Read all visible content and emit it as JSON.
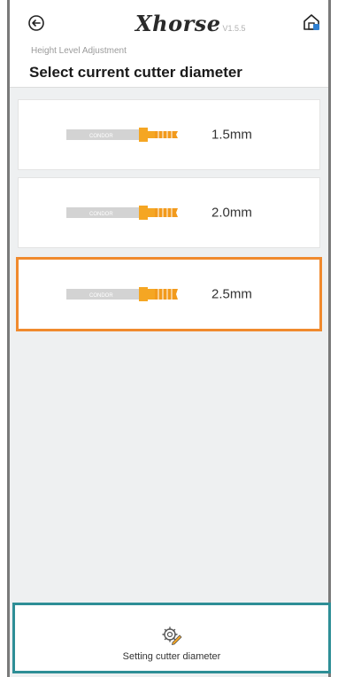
{
  "header": {
    "back_icon": "back-arrow-icon",
    "logo_text": "Xhorse",
    "version": "V1.5.5",
    "home_icon": "home-icon",
    "subtitle": "Height Level Adjustment",
    "title": "Select current cutter diameter"
  },
  "cutter_options": [
    {
      "label": "1.5mm",
      "engraving": "CONDOR",
      "selected": false
    },
    {
      "label": "2.0mm",
      "engraving": "CONDOR",
      "selected": false
    },
    {
      "label": "2.5mm",
      "engraving": "CONDOR",
      "selected": true
    }
  ],
  "footer": {
    "icon": "gear-pencil-icon",
    "label": "Setting cutter diameter"
  },
  "colors": {
    "accent_selected": "#f08a2e",
    "footer_border": "#2e8e96",
    "cutter_tip": "#f5a623",
    "cutter_shank": "#cfcfcf"
  }
}
